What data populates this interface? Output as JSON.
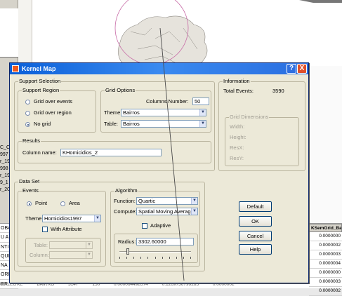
{
  "background": {
    "left_list": [
      "C_Ce",
      "997",
      "r_19",
      "998",
      "r_199",
      "9_1",
      "r_20"
    ],
    "table_left_cells": [
      "OBA",
      "U A",
      "NTI",
      "QUI",
      "NA",
      "ORIS",
      "RR"
    ],
    "table_right_header": "KSemGrid_Ba",
    "table_right_cells": [
      "0.0000000",
      "0.0000002",
      "0.0000003",
      "0.0000004",
      "0.0000000",
      "0.0000003",
      "0.0000002"
    ],
    "bottom_row": [
      "U ALEGRE",
      "BAIRRO",
      "3147",
      "150",
      "0.000064498574",
      "0.1269736799285",
      "0.0000002"
    ]
  },
  "dialog": {
    "title": "Kernel Map",
    "help_button": "?",
    "close_button": "X",
    "support_selection": {
      "title": "Support Selection",
      "support_region": {
        "title": "Support Region",
        "options": [
          "Grid over events",
          "Grid over region",
          "No grid"
        ],
        "selected": 2
      },
      "grid_options": {
        "title": "Grid Options",
        "columns_label": "Columns Number:",
        "columns_value": "50",
        "theme_label": "Theme:",
        "theme_value": "Bairros",
        "table_label": "Table:",
        "table_value": "Bairros"
      }
    },
    "results": {
      "title": "Results",
      "column_label": "Column name:",
      "column_value": "KHomicidios_2"
    },
    "information": {
      "title": "Information",
      "total_events_label": "Total Events:",
      "total_events_value": "3590",
      "grid_dimensions": {
        "title": "Grid Dimensions",
        "labels": [
          "Width:",
          "Height:",
          "ResX:",
          "ResY:"
        ]
      }
    },
    "data_set": {
      "title": "Data Set",
      "events": {
        "title": "Events",
        "point_label": "Point",
        "area_label": "Area",
        "selected": "Point",
        "theme_label": "Theme:",
        "theme_value": "Homicidios1997",
        "with_attribute_label": "With Attribute",
        "table_label": "Table:",
        "column_label": "Column:"
      },
      "algorithm": {
        "title": "Algorithm",
        "function_label": "Function:",
        "function_value": "Quartic",
        "compute_label": "Compute:",
        "compute_value": "Spatial Moving Average",
        "adaptive_label": "Adaptive",
        "radius_label": "Radius:",
        "radius_value": "3302.60000",
        "slider_level": 0.1
      }
    },
    "buttons": {
      "default": "Default",
      "ok": "OK",
      "cancel": "Cancel",
      "help": "Help"
    }
  }
}
